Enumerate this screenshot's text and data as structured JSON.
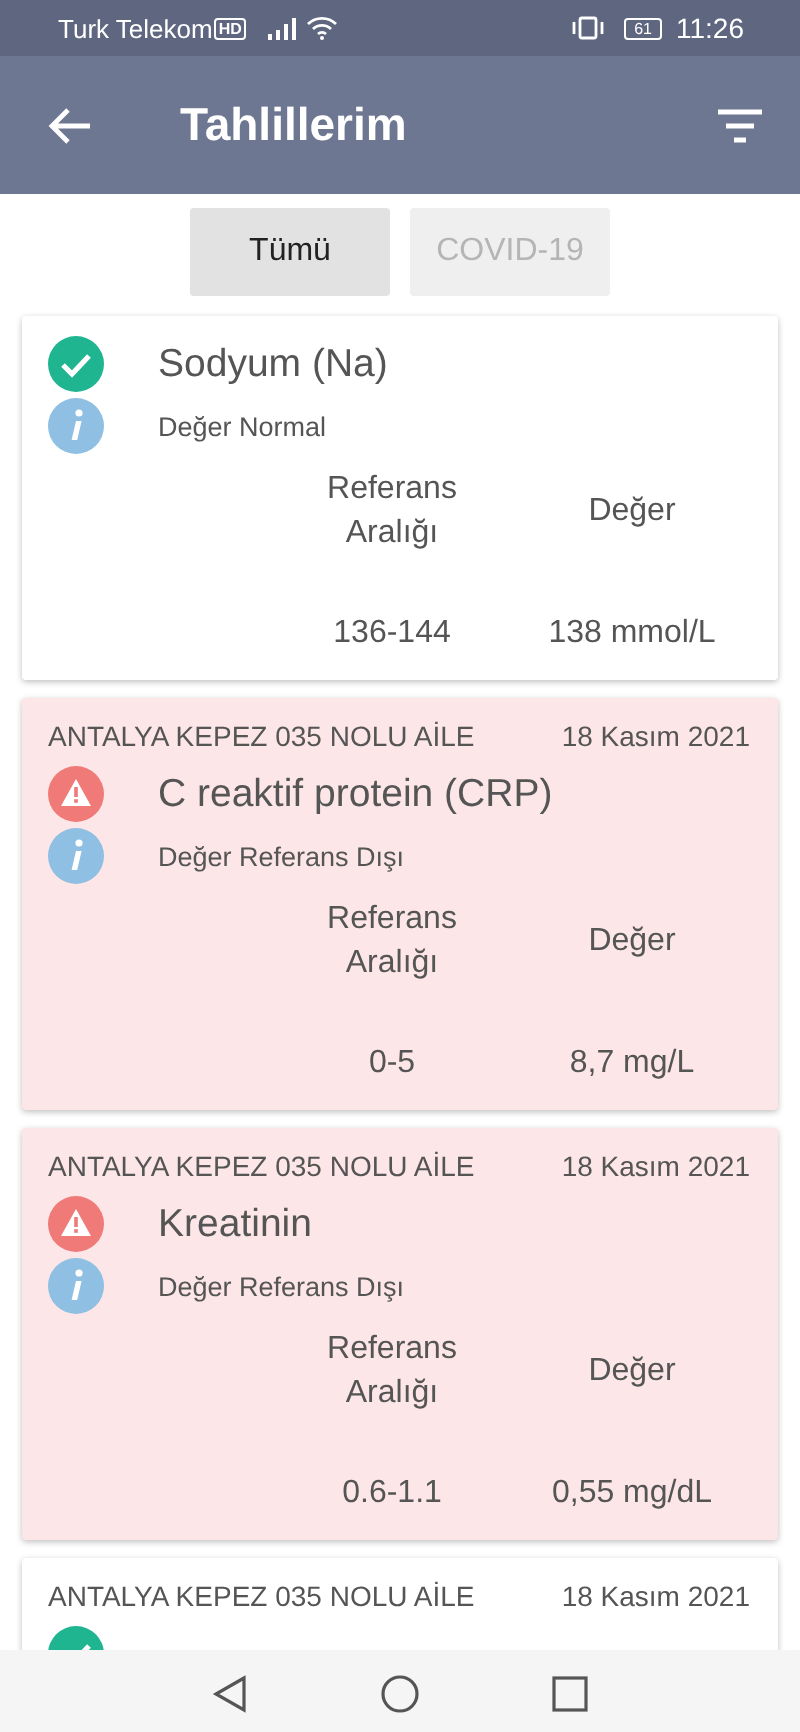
{
  "status_bar": {
    "carrier": "Turk Telekom",
    "network_badge": "HD",
    "battery": "61",
    "time": "11:26"
  },
  "app_bar": {
    "title": "Tahlillerim"
  },
  "tabs": [
    {
      "label": "Tümü",
      "selected": true
    },
    {
      "label": "COVID-19",
      "selected": false
    }
  ],
  "results": [
    {
      "kind": "normal",
      "test": "Sodyum (Na)",
      "note": "Değer Normal",
      "ref_header": "Referans Aralığı",
      "value_header": "Değer",
      "ref": "136-144",
      "value": "138 mmol/L"
    },
    {
      "kind": "abnormal",
      "source": "ANTALYA KEPEZ 035 NOLU AİLE",
      "date": "18 Kasım 2021",
      "test": "C reaktif protein (CRP)",
      "note": "Değer Referans Dışı",
      "ref_header": "Referans Aralığı",
      "value_header": "Değer",
      "ref": "0-5",
      "value": "8,7 mg/L"
    },
    {
      "kind": "abnormal",
      "source": "ANTALYA KEPEZ 035 NOLU AİLE",
      "date": "18 Kasım 2021",
      "test": "Kreatinin",
      "note": "Değer Referans Dışı",
      "ref_header": "Referans Aralığı",
      "value_header": "Değer",
      "ref": "0.6-1.1",
      "value": "0,55 mg/dL"
    },
    {
      "kind": "normal",
      "source": "ANTALYA KEPEZ 035 NOLU AİLE",
      "date": "18 Kasım 2021"
    }
  ]
}
